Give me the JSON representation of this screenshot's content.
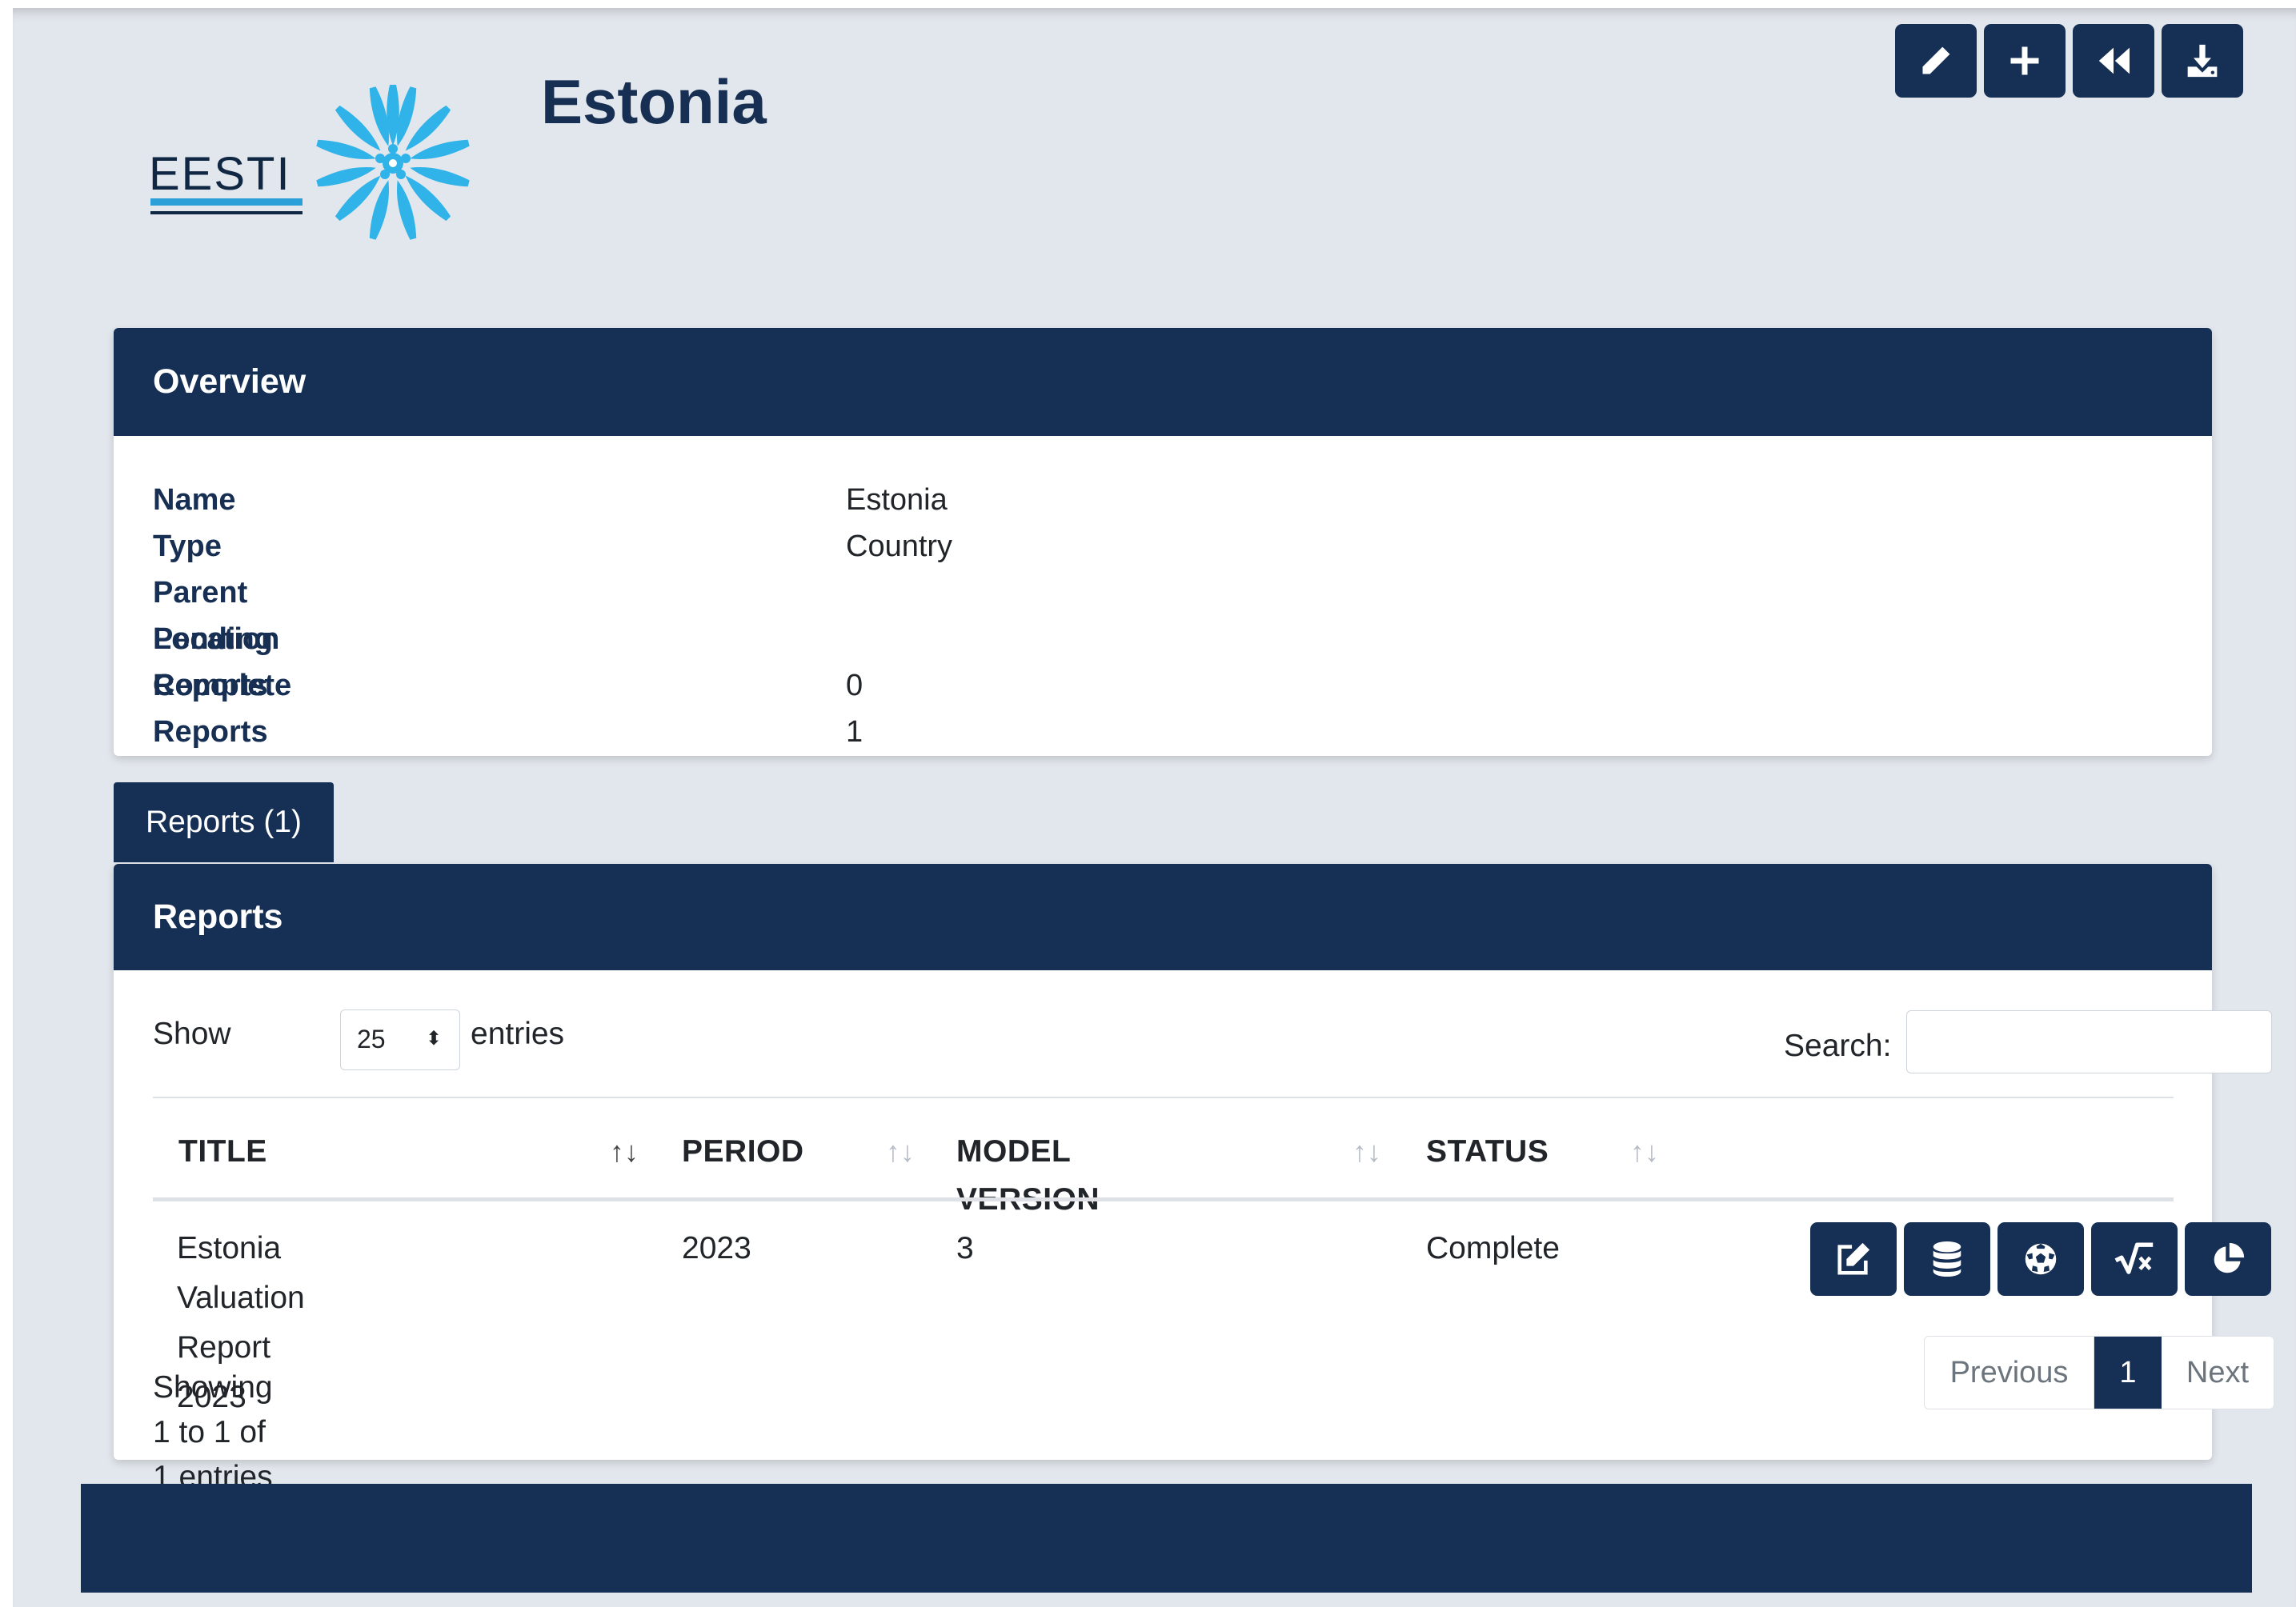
{
  "header": {
    "title": "Estonia",
    "logo_text": "EESTI"
  },
  "toolbar": {
    "buttons": [
      {
        "icon": "pencil-icon"
      },
      {
        "icon": "plus-icon"
      },
      {
        "icon": "rewind-icon"
      },
      {
        "icon": "download-icon"
      }
    ]
  },
  "overview": {
    "heading": "Overview",
    "rows": [
      {
        "label": "Name",
        "value": "Estonia"
      },
      {
        "label": "Type",
        "value": "Country"
      },
      {
        "label": "Parent Location",
        "value": ""
      },
      {
        "label": "Pending Reports",
        "value": "0"
      },
      {
        "label": "Complete Reports",
        "value": "1"
      }
    ]
  },
  "tabs": [
    {
      "label": "Reports (1)"
    }
  ],
  "reports": {
    "heading": "Reports",
    "show_label": "Show",
    "page_size": "25",
    "entries_label": "entries",
    "search_label": "Search:",
    "search_value": "",
    "columns": [
      "TITLE",
      "PERIOD",
      "MODEL VERSION",
      "STATUS"
    ],
    "rows": [
      {
        "title": "Estonia Valuation Report 2023",
        "period": "2023",
        "model_version": "3",
        "status": "Complete",
        "actions": [
          "edit-icon",
          "database-icon",
          "soccer-ball-icon",
          "square-root-icon",
          "pie-chart-icon"
        ]
      }
    ],
    "info": "Showing 1 to 1 of 1 entries",
    "pagination": {
      "previous": "Previous",
      "current": "1",
      "next": "Next"
    }
  },
  "colors": {
    "navy": "#162f54",
    "background": "#e2e7ed",
    "logo_blue": "#2fb3e8"
  }
}
